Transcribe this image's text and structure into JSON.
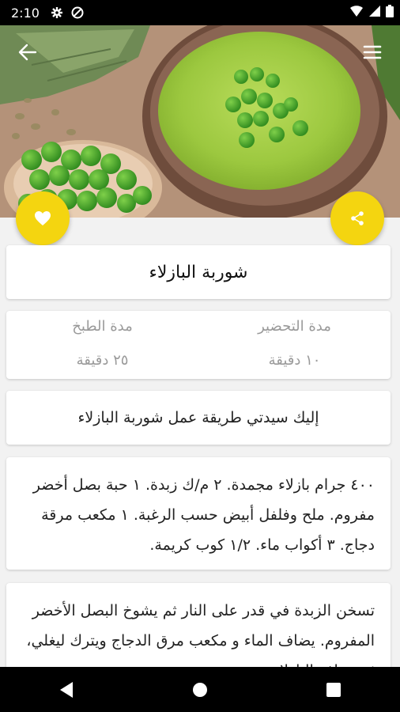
{
  "status_bar": {
    "time": "2:10"
  },
  "recipe": {
    "title": "شوربة البازلاء",
    "intro": "إليك سيدتي طريقة عمل شوربة البازلاء",
    "ingredients": "٤٠٠ جرام بازلاء مجمدة. ٢ م/ك زبدة. ١ حبة بصل أخضر مفروم. ملح وفلفل أبيض حسب الرغبة. ١ مكعب مرقة دجاج. ٣ أكواب ماء. ١/٢ كوب كريمة.",
    "steps": "تسخن الزبدة في قدر على النار ثم يشوخ البصل الأخضر المفروم. يضاف الماء و مكعب مرق الدجاج ويترك ليغلي، ثم تضاف البازلاء"
  },
  "times": {
    "prep_label": "مدة التحضير",
    "prep_value": "١٠ دقيقة",
    "cook_label": "مدة الطبخ",
    "cook_value": "٢٥ دقيقة"
  },
  "colors": {
    "accent": "#f4d510",
    "card_bg": "#ffffff",
    "page_bg": "#f2f2f2"
  },
  "icons": {
    "back": "arrow-back-icon",
    "menu": "menu-icon",
    "favorite": "heart-icon",
    "share": "share-icon"
  }
}
